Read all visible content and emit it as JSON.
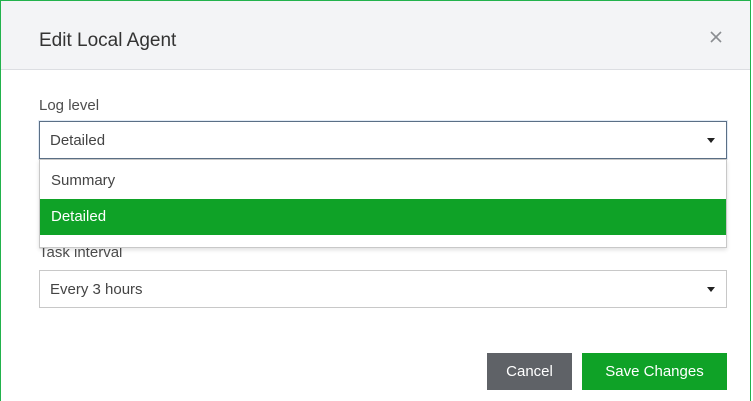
{
  "dialog": {
    "title": "Edit Local Agent",
    "close_icon": "close-icon"
  },
  "form": {
    "log_level": {
      "label": "Log level",
      "selected": "Detailed",
      "options": [
        "Summary",
        "Detailed"
      ],
      "highlighted_option": "Detailed"
    },
    "task_interval": {
      "label": "Task interval",
      "selected": "Every 3 hours"
    }
  },
  "footer": {
    "cancel_label": "Cancel",
    "save_label": "Save Changes"
  },
  "colors": {
    "accent": "#0fa227",
    "border_accent": "#22b24c",
    "cancel_bg": "#5f6267",
    "header_bg": "#f3f4f6"
  }
}
